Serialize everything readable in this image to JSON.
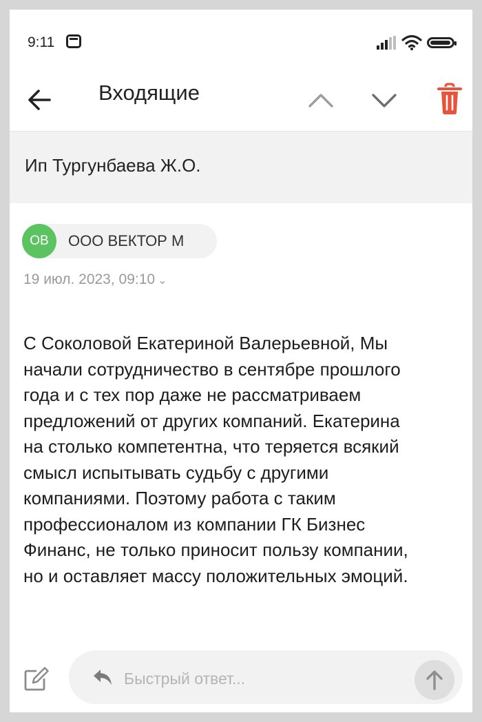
{
  "status_bar": {
    "time": "9:11",
    "icons": [
      "mail-notification-icon",
      "signal-icon",
      "wifi-icon",
      "battery-icon"
    ]
  },
  "toolbar": {
    "title": "Входящие",
    "icons": [
      "arrow-left-icon",
      "chevron-up-icon",
      "chevron-down-icon",
      "trash-icon"
    ],
    "trash_color": "#e8533b"
  },
  "message": {
    "subject": "Ип Тургунбаева Ж.О.",
    "sender": {
      "initials": "ОВ",
      "name": "ООО ВЕКТОР М",
      "avatar_color": "#5bc461"
    },
    "date": "19 июл. 2023, 09:10",
    "body": "С Соколовой Екатериной Валерьевной, Мы\nначали сотрудничество в сентябре прошлого\nгода и с тех пор даже не рассматриваем\nпредложений от других компаний. Екатерина\nна столько компетентна, что теряется всякий\nсмысл испытывать судьбу с другими\nкомпаниями. Поэтому работа с таким\nпрофессионалом из компании ГК Бизнес\nФинанс, не только приносит пользу компании,\nно и оставляет массу положительных эмоций."
  },
  "quick_reply": {
    "placeholder": "Быстрый ответ...",
    "value": "",
    "icons": [
      "edit-icon",
      "reply-arrow-icon",
      "send-arrow-up-icon"
    ]
  }
}
